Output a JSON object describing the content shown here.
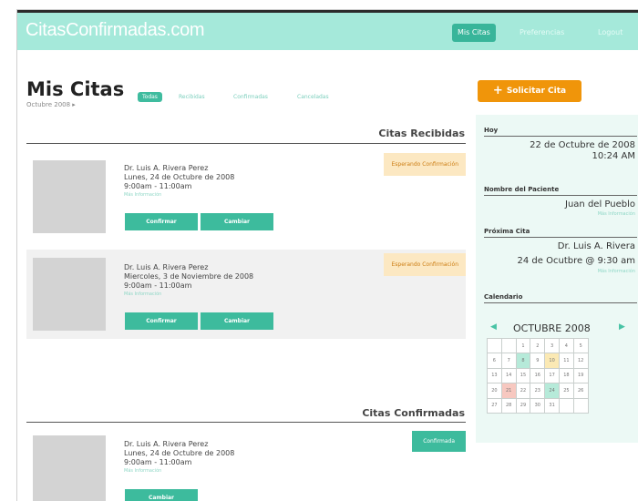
{
  "site": {
    "logo": "CitasConfirmadas.com"
  },
  "nav": {
    "mis_citas": "Mis Citas",
    "preferencias": "Preferencias",
    "logout": "Logout"
  },
  "page": {
    "title": "Mis Citas",
    "month_link": "Octubre 2008 ▸"
  },
  "filters": {
    "todas": "Todas",
    "recibidas": "Recibidas",
    "confirmadas": "Confirmadas",
    "canceladas": "Canceladas"
  },
  "request_button": {
    "label": "Solicitar Cita",
    "icon": "plus-icon"
  },
  "sections": {
    "recibidas": "Citas Recibidas",
    "confirmadas": "Citas Confirmadas"
  },
  "appointments": [
    {
      "doctor": "Dr. Luis A. Rivera Perez",
      "date": "Lunes, 24 de Octubre de 2008",
      "time": "9:00am - 11:00am",
      "more": "Más Información",
      "status": "Esperando Confirmación",
      "confirm_label": "Confirmar",
      "change_label": "Cambiar"
    },
    {
      "doctor": "Dr. Luis A. Rivera Perez",
      "date": "Miercoles, 3 de Noviembre de 2008",
      "time": "9:00am - 11:00am",
      "more": "Más Información",
      "status": "Esperando Confirmación",
      "confirm_label": "Confirmar",
      "change_label": "Cambiar"
    },
    {
      "doctor": "Dr. Luis A. Rivera Perez",
      "date": "Lunes, 24 de Octubre de 2008",
      "time": "9:00am - 11:00am",
      "more": "Más Información",
      "status": "Confirmada",
      "change_label": "Cambiar"
    }
  ],
  "sidebar": {
    "today_label": "Hoy",
    "today_date": "22 de Octubre de 2008",
    "today_time": "10:24 AM",
    "patient_label": "Nombre del Paciente",
    "patient_name": "Juan del Pueblo",
    "patient_more": "Más Información",
    "next_label": "Próxima Cita",
    "next_doctor": "Dr. Luis A. Rivera",
    "next_date": "24 de Ocutbre @ 9:30 am",
    "next_more": "Más Información",
    "calendar_label": "Calendario"
  },
  "calendar": {
    "month": "OCTUBRE 2008",
    "prev": "◀",
    "next": "▶",
    "weeks": [
      [
        "",
        "",
        "1",
        "2",
        "3",
        "4",
        "5"
      ],
      [
        "6",
        "7",
        "8",
        "9",
        "10",
        "11",
        "12"
      ],
      [
        "13",
        "14",
        "15",
        "16",
        "17",
        "18",
        "19"
      ],
      [
        "20",
        "21",
        "22",
        "23",
        "24",
        "25",
        "26"
      ],
      [
        "27",
        "28",
        "29",
        "30",
        "31",
        "",
        ""
      ]
    ],
    "highlights": {
      "8": "#b6ead9",
      "10": "#fbe9b4",
      "21": "#f7c8c0",
      "24": "#b6ead9"
    }
  },
  "colors": {
    "brand": "#a5e9da",
    "accent": "#3dbb9d",
    "request": "#f0950a",
    "pending_bg": "#fce8c2",
    "pending_text": "#cc7d13"
  }
}
